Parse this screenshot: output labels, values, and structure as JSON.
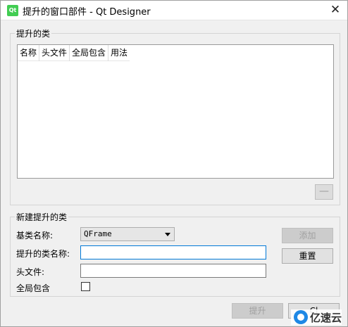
{
  "window": {
    "icon_text": "Qt",
    "title": "提升的窗口部件 - Qt Designer",
    "close_glyph": "✕"
  },
  "promoted_group": {
    "title": "提升的类",
    "columns": [
      "名称",
      "头文件",
      "全局包含",
      "用法"
    ],
    "rows": [],
    "remove_label": "—"
  },
  "new_group": {
    "title": "新建提升的类",
    "base_class_label": "基类名称:",
    "base_class_value": "QFrame",
    "class_name_label": "提升的类名称:",
    "class_name_value": "",
    "header_label": "头文件:",
    "header_value": "",
    "global_include_label": "全局包含",
    "global_include_checked": false,
    "add_label": "添加",
    "reset_label": "重置"
  },
  "footer": {
    "promote_label": "提升",
    "close_label": "Cl"
  },
  "watermark": {
    "text": "亿速云"
  }
}
